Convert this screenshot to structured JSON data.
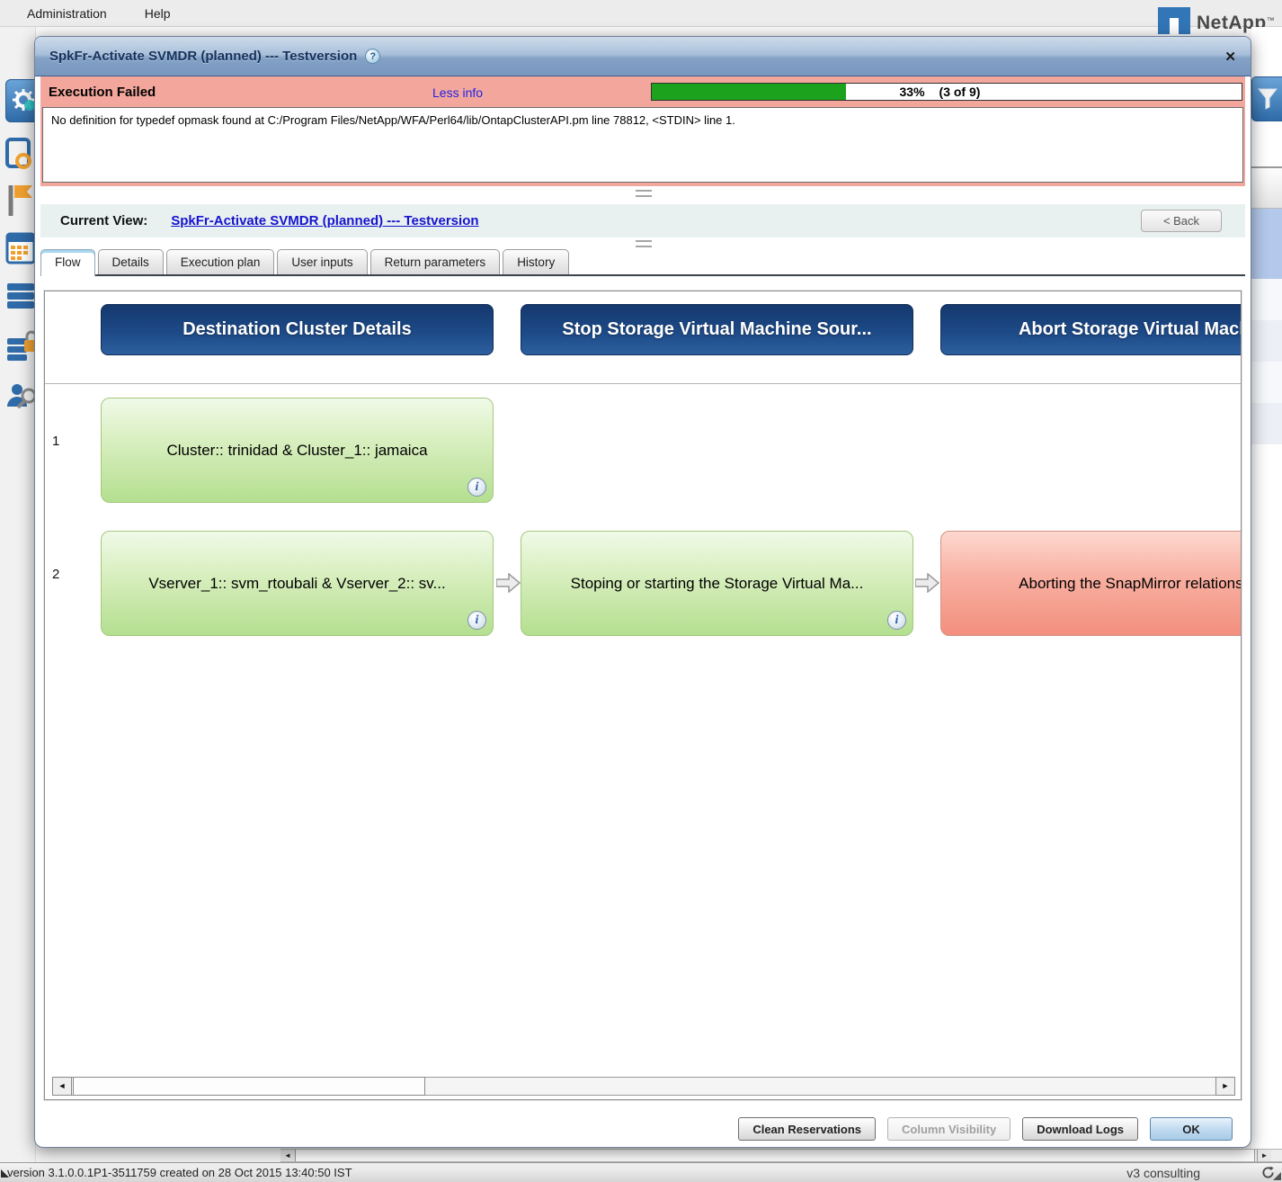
{
  "menu": {
    "items": [
      "Administration",
      "Help"
    ]
  },
  "brand": {
    "logo": "NetApp",
    "trademark": "™"
  },
  "dialog": {
    "title": "SpkFr-Activate SVMDR (planned) --- Testversion",
    "help_badge": "?",
    "close": "✕",
    "banner": {
      "status": "Execution Failed",
      "toggle": "Less info",
      "progress": {
        "percent": 33,
        "percent_label": "33%",
        "count_label": "(3 of 9)"
      },
      "error": "No definition for typedef opmask found at C:/Program Files/NetApp/WFA/Perl64/lib/OntapClusterAPI.pm line 78812, <STDIN> line 1."
    },
    "current_view": {
      "label": "Current View:",
      "link": "SpkFr-Activate SVMDR (planned) --- Testversion",
      "back": "< Back"
    },
    "tabs": [
      {
        "label": "Flow",
        "active": true
      },
      {
        "label": "Details",
        "active": false
      },
      {
        "label": "Execution plan",
        "active": false
      },
      {
        "label": "User inputs",
        "active": false
      },
      {
        "label": "Return parameters",
        "active": false
      },
      {
        "label": "History",
        "active": false
      }
    ],
    "flow": {
      "columns": [
        "Destination Cluster Details",
        "Stop Storage Virtual Machine Sour...",
        "Abort Storage Virtual Machi"
      ],
      "rows": [
        {
          "number": "1",
          "steps": [
            {
              "label": "Cluster:: trinidad & Cluster_1:: jamaica",
              "state": "success"
            }
          ]
        },
        {
          "number": "2",
          "steps": [
            {
              "label": "Vserver_1:: svm_rtoubali & Vserver_2:: sv...",
              "state": "success"
            },
            {
              "label": "Stoping or starting the Storage Virtual Ma...",
              "state": "success"
            },
            {
              "label": "Aborting the SnapMirror relationshi",
              "state": "failed"
            }
          ]
        }
      ]
    },
    "footer": {
      "buttons": [
        {
          "label": "Clean Reservations",
          "enabled": true
        },
        {
          "label": "Column Visibility",
          "enabled": false
        },
        {
          "label": "Download Logs",
          "enabled": true
        },
        {
          "label": "OK",
          "enabled": true,
          "primary": true
        }
      ]
    }
  },
  "statusbar": {
    "left": "version 3.1.0.0.1P1-3511759 created on 28 Oct 2015 13:40:50 IST",
    "right": "v3 consulting"
  },
  "colors": {
    "banner_pink": "#f3a79c",
    "progress_green": "#1ca21c",
    "header_blue": "#1d4a87",
    "success_box_green": "#b4df90",
    "failed_box_red": "#f38f7e",
    "link_blue": "#1613cf",
    "titlebar_blue": "#84a2c6"
  }
}
